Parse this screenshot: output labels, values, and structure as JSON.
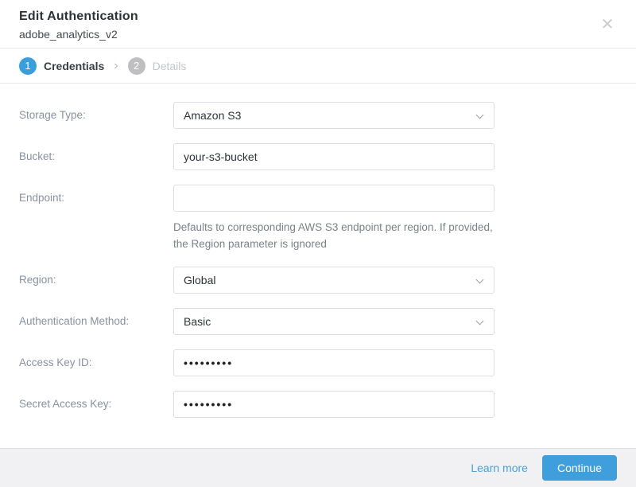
{
  "modal": {
    "title": "Edit Authentication",
    "subtitle": "adobe_analytics_v2",
    "close_icon": "✕"
  },
  "steps": {
    "separator": "›",
    "items": [
      {
        "name": "credentials",
        "number": "1",
        "label": "Credentials",
        "active": true
      },
      {
        "name": "details",
        "number": "2",
        "label": "Details",
        "active": false
      }
    ]
  },
  "form": {
    "fields": [
      {
        "name": "storage-type",
        "label": "Storage Type:",
        "type": "select",
        "value": "Amazon S3"
      },
      {
        "name": "bucket",
        "label": "Bucket:",
        "type": "text",
        "value": "your-s3-bucket"
      },
      {
        "name": "endpoint",
        "label": "Endpoint:",
        "type": "text",
        "value": "",
        "helper": "Defaults to corresponding AWS S3 endpoint per region. If provided, the Region parameter is ignored"
      },
      {
        "name": "region",
        "label": "Region:",
        "type": "select",
        "value": "Global"
      },
      {
        "name": "authentication-method",
        "label": "Authentication Method:",
        "type": "select",
        "value": "Basic"
      },
      {
        "name": "access-key-id",
        "label": "Access Key ID:",
        "type": "password",
        "value": "•••••••••"
      },
      {
        "name": "secret-access-key",
        "label": "Secret Access Key:",
        "type": "password",
        "value": "•••••••••"
      }
    ]
  },
  "footer": {
    "learn_more_label": "Learn more",
    "continue_label": "Continue"
  },
  "colors": {
    "accent_blue": "#3e9fdc",
    "inactive_gray": "#bfbfc1",
    "footer_bg": "#f1f1f3"
  }
}
